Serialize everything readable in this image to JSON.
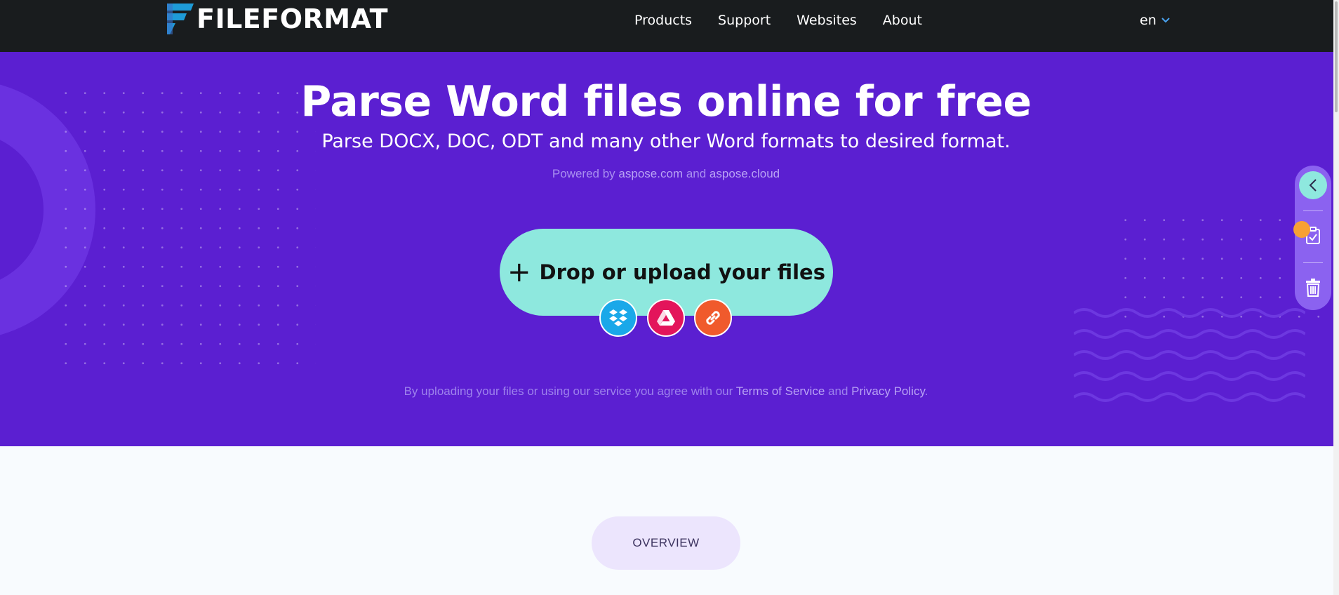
{
  "header": {
    "logo_text": "FILEFORMAT",
    "nav": [
      "Products",
      "Support",
      "Websites",
      "About"
    ],
    "language": "en"
  },
  "hero": {
    "title": "Parse Word files online for free",
    "subtitle": "Parse DOCX, DOC, ODT and many other Word formats to desired format.",
    "powered_prefix": "Powered by",
    "powered_link1": "aspose.com",
    "powered_and": "and",
    "powered_link2": "aspose.cloud",
    "upload_label": "Drop or upload your files",
    "sources": [
      "dropbox-icon",
      "google-drive-icon",
      "link-icon"
    ],
    "terms_prefix": "By uploading your files or using our service you agree with our",
    "terms_link": "Terms of Service",
    "terms_and": "and",
    "privacy_link": "Privacy Policy",
    "terms_suffix": "."
  },
  "side_toolbar": {
    "icons": [
      "chevron-left-icon",
      "clipboard-check-icon",
      "trash-icon"
    ]
  },
  "overview": {
    "label": "OVERVIEW"
  },
  "colors": {
    "header_bg": "#191c1e",
    "hero_bg": "#5b1fd1",
    "accent_teal": "#8ee8de",
    "dropbox": "#1aa8e9",
    "drive": "#e3155b",
    "url": "#f05a2c",
    "notification": "#f7a033"
  }
}
